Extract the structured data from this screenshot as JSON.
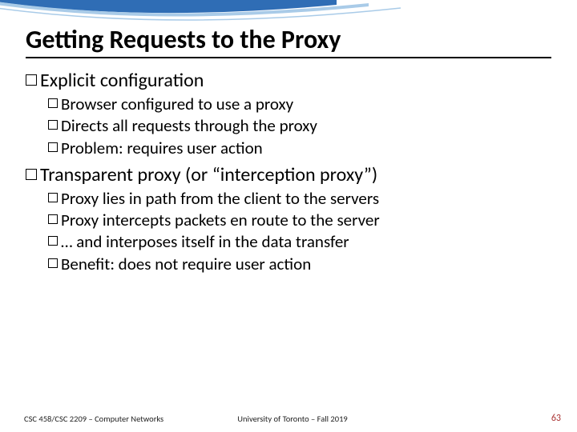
{
  "title": "Getting Requests to the Proxy",
  "sections": [
    {
      "heading": "Explicit configuration",
      "items": [
        "Browser configured to use a proxy",
        "Directs all requests through the proxy",
        "Problem: requires user action"
      ]
    },
    {
      "heading": "Transparent proxy (or “interception proxy”)",
      "items": [
        "Proxy lies in path from the client to the servers",
        "Proxy intercepts packets en route to the server",
        "… and interposes itself in the data transfer",
        "Benefit: does not require user action"
      ]
    }
  ],
  "footer": {
    "left": "CSC 458/CSC 2209 – Computer Networks",
    "center": "University of Toronto – Fall 2019",
    "page": "63"
  },
  "colors": {
    "swoosh_top": "#2f6db5",
    "swoosh_light": "#a9cbe8",
    "page_accent": "#a33"
  }
}
